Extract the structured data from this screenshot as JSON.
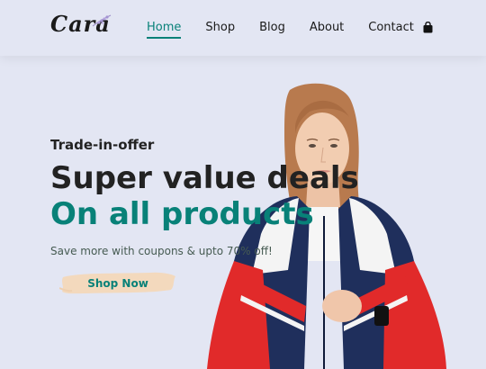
{
  "header": {
    "logo": "Cara",
    "nav": [
      {
        "label": "Home",
        "active": true
      },
      {
        "label": "Shop",
        "active": false
      },
      {
        "label": "Blog",
        "active": false
      },
      {
        "label": "About",
        "active": false
      },
      {
        "label": "Contact",
        "active": false
      }
    ],
    "cart_icon": "shopping-bag-icon"
  },
  "hero": {
    "eyebrow": "Trade-in-offer",
    "headline_1": "Super value deals",
    "headline_2": "On all products",
    "subtext": "Save more with coupons & upto 70% off!",
    "button_label": "Shop Now"
  },
  "colors": {
    "accent": "#088178",
    "background": "#e3e6f3",
    "button_brush": "#f3d9bd"
  }
}
